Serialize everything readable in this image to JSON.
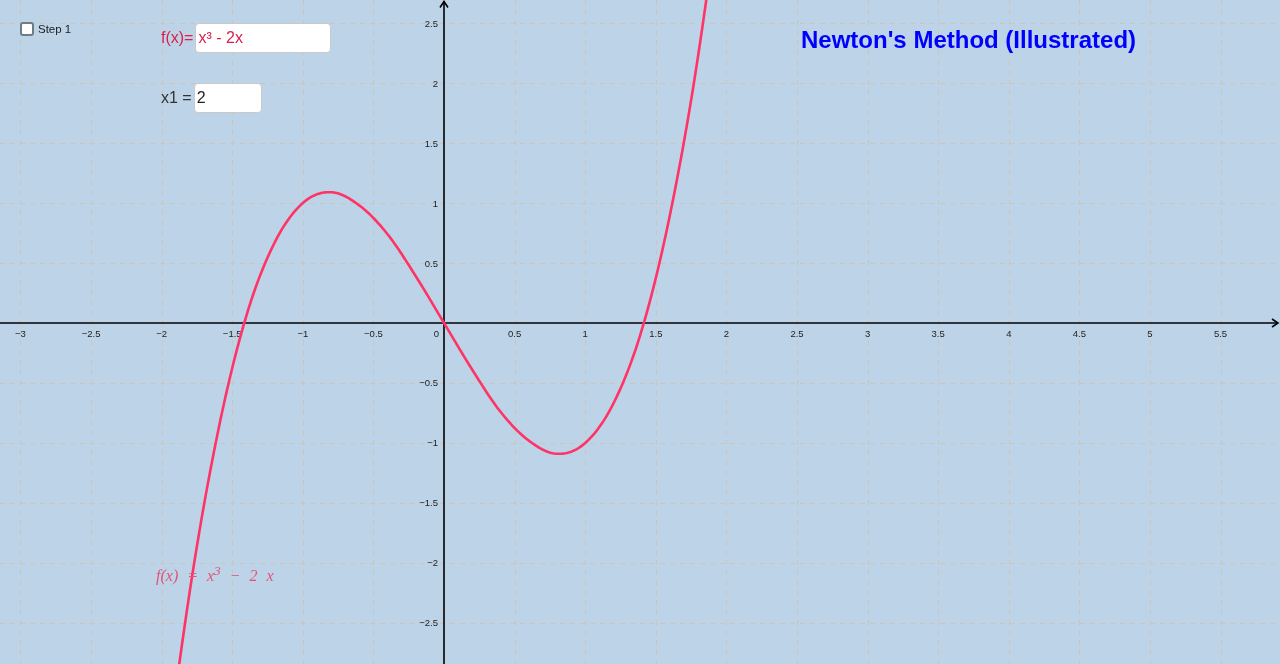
{
  "step_checkbox": {
    "label": "Step 1",
    "checked": false
  },
  "function_input": {
    "label": "f(x)=",
    "value": "x³ - 2x"
  },
  "initial_value_input": {
    "label": "x1 =",
    "value": "2"
  },
  "title": "Newton's Method (Illustrated)",
  "graph": {
    "chart_data": {
      "type": "line",
      "x": [
        -1.875,
        -1.8,
        -1.6,
        -1.4,
        -1.2,
        -1.0,
        -0.8,
        -0.6,
        -0.4,
        -0.2,
        0,
        0.2,
        0.4,
        0.6,
        0.8,
        1.0,
        1.2,
        1.4,
        1.6,
        1.8,
        1.857
      ],
      "series": [
        {
          "name": "f(x) = x$^{3}$ − 2 x",
          "color": "#ff3366",
          "values": [
            -2.84,
            -2.23,
            -0.9,
            0.06,
            0.67,
            1,
            1.09,
            0.98,
            0.74,
            0.39,
            0,
            -0.39,
            -0.74,
            -0.98,
            -1.09,
            -1,
            -0.67,
            -0.06,
            0.9,
            2.23,
            2.69
          ]
        }
      ],
      "xlim": [
        -3.145,
        5.921
      ],
      "ylim": [
        -2.842,
        2.692
      ],
      "xticks": [
        {
          "value": -3,
          "label": "−3"
        },
        {
          "value": -2.5,
          "label": "−2.5"
        },
        {
          "value": -2,
          "label": "−2"
        },
        {
          "value": -1.5,
          "label": "−1.5"
        },
        {
          "value": -1,
          "label": "−1"
        },
        {
          "value": -0.5,
          "label": "−0.5"
        },
        0,
        0.5,
        1,
        1.5,
        2,
        2.5,
        3,
        3.5,
        4,
        4.5,
        5,
        5.5
      ],
      "yticks": [
        {
          "value": -2.5,
          "label": "−2.5"
        },
        {
          "value": -2,
          "label": "−2"
        },
        {
          "value": -1.5,
          "label": "−1.5"
        },
        {
          "value": -1,
          "label": "−1"
        },
        {
          "value": -0.5,
          "label": "−0.5"
        },
        0.5,
        1,
        1.5,
        2,
        2.5
      ],
      "grid": true
    }
  }
}
